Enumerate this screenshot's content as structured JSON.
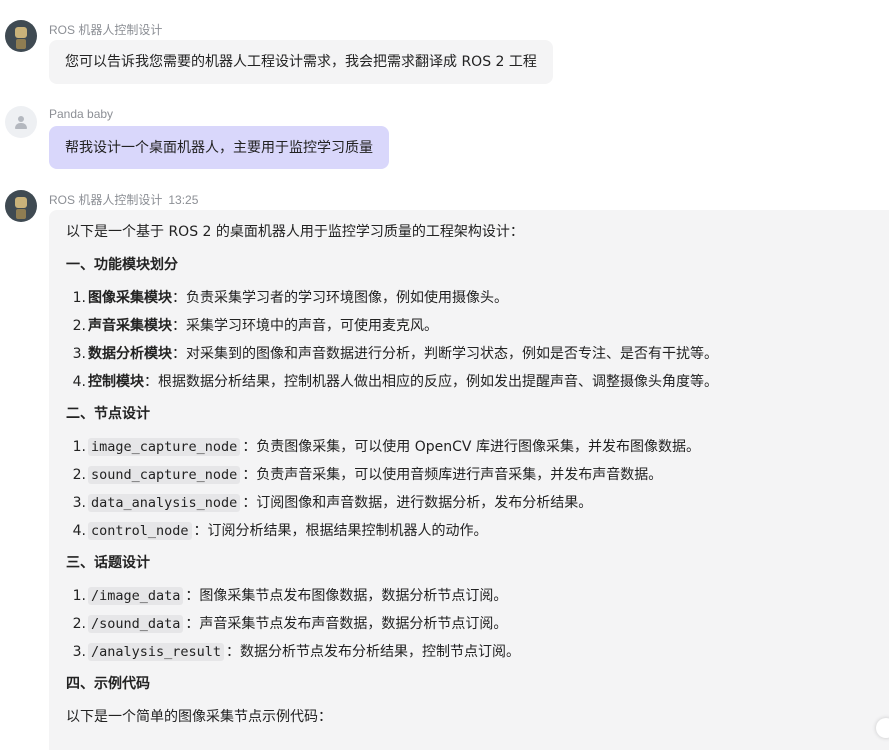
{
  "messages": [
    {
      "sender": "ROS 机器人控制设计",
      "text": "您可以告诉我您需要的机器人工程设计需求，我会把需求翻译成 ROS 2 工程"
    },
    {
      "sender": "Panda baby",
      "text": "帮我设计一个桌面机器人，主要用于监控学习质量"
    },
    {
      "sender": "ROS 机器人控制设计",
      "time": "13:25",
      "intro": "以下是一个基于 ROS 2 的桌面机器人用于监控学习质量的工程架构设计：",
      "sections": [
        {
          "title": "一、功能模块划分",
          "items": [
            {
              "num": "1.",
              "label": "图像采集模块",
              "desc": "：负责采集学习者的学习环境图像，例如使用摄像头。"
            },
            {
              "num": "2.",
              "label": "声音采集模块",
              "desc": "：采集学习环境中的声音，可使用麦克风。"
            },
            {
              "num": "3.",
              "label": "数据分析模块",
              "desc": "：对采集到的图像和声音数据进行分析，判断学习状态，例如是否专注、是否有干扰等。"
            },
            {
              "num": "4.",
              "label": "控制模块",
              "desc": "：根据数据分析结果，控制机器人做出相应的反应，例如发出提醒声音、调整摄像头角度等。"
            }
          ]
        },
        {
          "title": "二、节点设计",
          "items": [
            {
              "num": "1.",
              "code": "image_capture_node",
              "desc": "：负责图像采集，可以使用 OpenCV 库进行图像采集，并发布图像数据。"
            },
            {
              "num": "2.",
              "code": "sound_capture_node",
              "desc": "：负责声音采集，可以使用音频库进行声音采集，并发布声音数据。"
            },
            {
              "num": "3.",
              "code": "data_analysis_node",
              "desc": "：订阅图像和声音数据，进行数据分析，发布分析结果。"
            },
            {
              "num": "4.",
              "code": "control_node",
              "desc": "：订阅分析结果，根据结果控制机器人的动作。"
            }
          ]
        },
        {
          "title": "三、话题设计",
          "items": [
            {
              "num": "1.",
              "code": "/image_data",
              "desc": "：图像采集节点发布图像数据，数据分析节点订阅。"
            },
            {
              "num": "2.",
              "code": "/sound_data",
              "desc": "：声音采集节点发布声音数据，数据分析节点订阅。"
            },
            {
              "num": "3.",
              "code": "/analysis_result",
              "desc": "：数据分析节点发布分析结果，控制节点订阅。"
            }
          ]
        },
        {
          "title": "四、示例代码",
          "items": []
        }
      ],
      "outro": "以下是一个简单的图像采集节点示例代码："
    }
  ],
  "colors": {
    "assistant_bubble": "#f4f4f5",
    "user_bubble": "#d9d7fb",
    "code_bg": "#e6e6e8",
    "sender_text": "#8c8f95"
  },
  "icons": {
    "assistant_avatar": "robot-avatar-icon",
    "user_avatar": "default-user-avatar-icon"
  }
}
